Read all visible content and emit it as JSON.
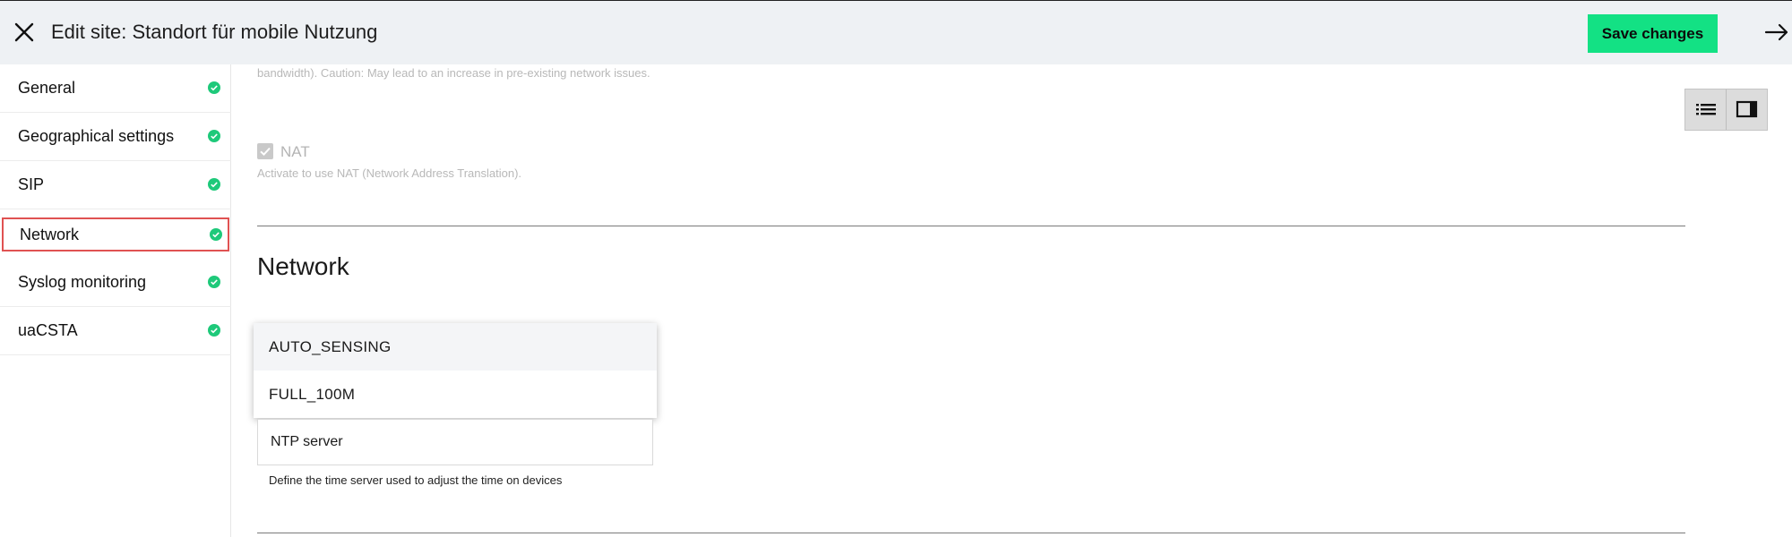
{
  "header": {
    "title": "Edit site: Standort für mobile Nutzung",
    "save_label": "Save changes"
  },
  "sidebar": {
    "items": [
      {
        "label": "General",
        "status": "complete"
      },
      {
        "label": "Geographical settings",
        "status": "complete"
      },
      {
        "label": "SIP",
        "status": "complete"
      },
      {
        "label": "Network",
        "status": "complete",
        "active": true
      },
      {
        "label": "Syslog monitoring",
        "status": "complete"
      },
      {
        "label": "uaCSTA",
        "status": "complete"
      }
    ]
  },
  "content": {
    "bandwidth_help": "bandwidth). Caution: May lead to an increase in pre-existing network issues.",
    "nat": {
      "label": "NAT",
      "help": "Activate to use NAT (Network Address Translation).",
      "checked": true,
      "disabled": true
    },
    "section_title": "Network",
    "dropdown": {
      "options": [
        "AUTO_SENSING",
        "FULL_100M"
      ],
      "highlighted": "AUTO_SENSING"
    },
    "ntp": {
      "placeholder": "NTP server",
      "help": "Define the time server used to adjust the time on devices"
    }
  },
  "colors": {
    "accent": "#13e184",
    "header_bg": "#eef1f4",
    "active_outline": "#e05252",
    "check_green": "#1ec97a"
  }
}
